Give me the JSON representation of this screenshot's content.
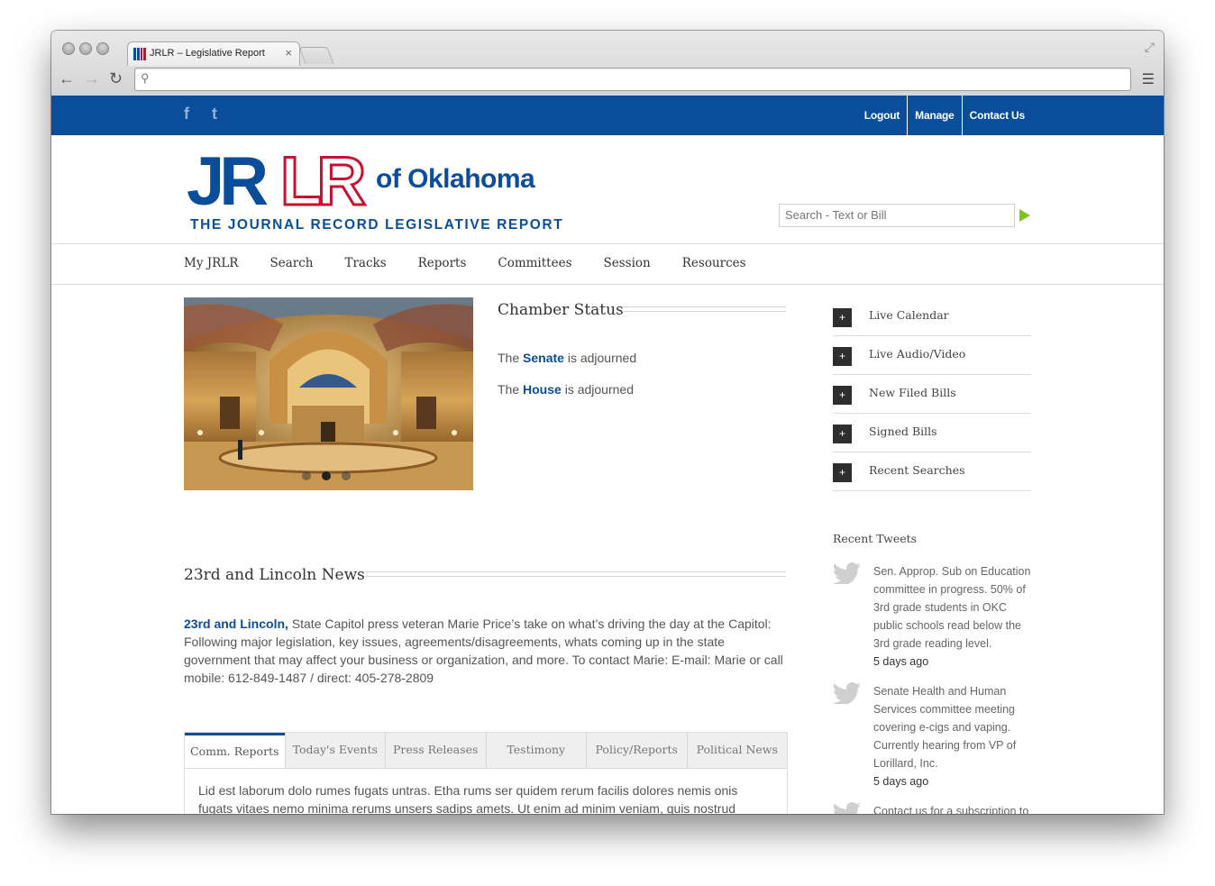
{
  "browser": {
    "tab_title": "JRLR – Legislative Report",
    "tab_close": "×",
    "url": ""
  },
  "topbar": {
    "social": [
      "f",
      "t"
    ],
    "links": [
      "Logout",
      "Manage",
      "Contact Us"
    ]
  },
  "logo": {
    "jr": "JR",
    "lr": "LR",
    "of": "of Oklahoma",
    "tagline": "THE JOURNAL RECORD LEGISLATIVE REPORT"
  },
  "search": {
    "placeholder": "Search - Text or Bill"
  },
  "mainnav": [
    "My JRLR",
    "Search",
    "Tracks",
    "Reports",
    "Committees",
    "Session",
    "Resources"
  ],
  "chamber": {
    "title": "Chamber Status",
    "lines": [
      {
        "pre": "The",
        "chamber": "Senate",
        "post": "is adjourned"
      },
      {
        "pre": "The",
        "chamber": "House",
        "post": "is adjourned"
      }
    ]
  },
  "slider": {
    "active_slide": 2,
    "slide_count": 3
  },
  "news": {
    "title": "23rd and Lincoln News",
    "lead": "23rd and Lincoln,",
    "body": " State Capitol press veteran Marie Price’s take on what’s driving the day at the Capitol: Following major legislation, key issues, agreements/disagreements, whats coming up in the state government that may affect your business or organization, and more. To contact Marie: E-mail: Marie or call mobile: 612-849-1487 / direct: 405-278-2809"
  },
  "tabs": {
    "items": [
      "Comm. Reports",
      "Today's Events",
      "Press Releases",
      "Testimony",
      "Policy/Reports",
      "Political News"
    ],
    "active": 0,
    "body": "Lid est laborum dolo rumes fugats untras. Etha rums ser quidem rerum facilis dolores nemis onis fugats vitaes nemo minima rerums unsers sadips amets. Ut enim ad minim veniam, quis nostrud"
  },
  "sidebar": {
    "items": [
      "Live Calendar",
      "Live Audio/Video",
      "New Filed Bills",
      "Signed Bills",
      "Recent Searches"
    ],
    "plus": "+"
  },
  "tweets": {
    "title": "Recent Tweets",
    "items": [
      {
        "text": "Sen. Approp. Sub on Education committee in progress. 50% of 3rd grade students in OKC public schools read below the 3rd grade reading level.",
        "ago": "5 days ago"
      },
      {
        "text": "Senate Health and Human Services committee meeting covering e-cigs and vaping. Currently hearing from VP of Lorillard, Inc.",
        "ago": "5 days ago"
      },
      {
        "text": "Contact us for a subscription to",
        "ago": ""
      }
    ]
  }
}
